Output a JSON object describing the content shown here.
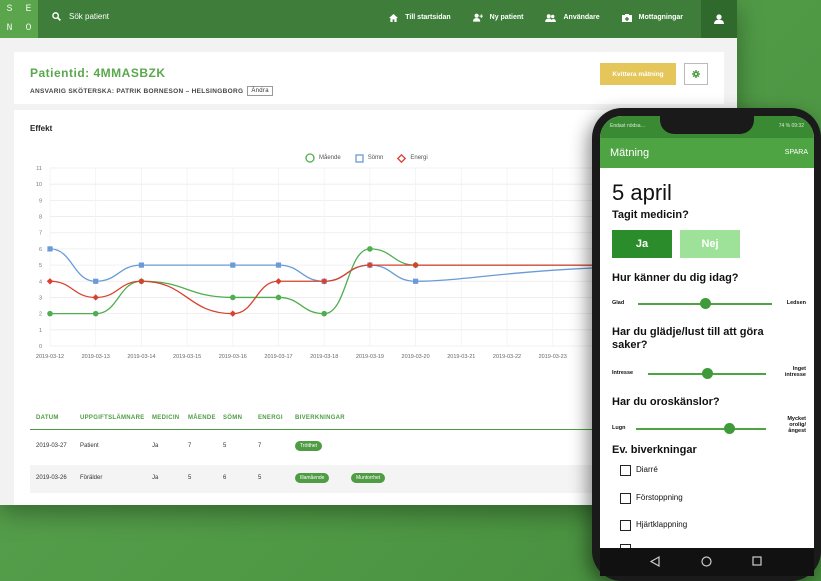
{
  "app": {
    "logo_letters": [
      "S",
      "E",
      "N",
      "O"
    ]
  },
  "topnav": {
    "search_label": "Sök patient",
    "links": [
      "Till startsidan",
      "Ny patient",
      "Användare",
      "Mottagningar"
    ]
  },
  "patient": {
    "id_label": "Patientid: 4MMASBZK",
    "responsible": "ANSVARIG SKÖTERSKA: PATRIK BORNESON – HELSINGBORG",
    "edit_label": "Ändra",
    "confirm_button": "Kvittera mätning"
  },
  "chart_title": "Effekt",
  "chart_data": {
    "type": "line",
    "x": [
      "2019-03-12",
      "2019-03-13",
      "2019-03-14",
      "2019-03-15",
      "2019-03-16",
      "2019-03-17",
      "2019-03-18",
      "2019-03-19",
      "2019-03-20",
      "2019-03-21",
      "2019-03-22",
      "2019-03-23"
    ],
    "ylim": [
      0,
      11
    ],
    "yticks": [
      0,
      1,
      2,
      3,
      4,
      5,
      6,
      7,
      8,
      9,
      10,
      11
    ],
    "series": [
      {
        "name": "Mående",
        "color": "#4fae4f",
        "marker": "circle",
        "points": [
          [
            "2019-03-12",
            2
          ],
          [
            "2019-03-13",
            2
          ],
          [
            "2019-03-14",
            4
          ],
          [
            "2019-03-16",
            3
          ],
          [
            "2019-03-17",
            3
          ],
          [
            "2019-03-18",
            2
          ],
          [
            "2019-03-19",
            6
          ],
          [
            "2019-03-20",
            5
          ]
        ]
      },
      {
        "name": "Sömn",
        "color": "#6a9bd6",
        "marker": "square",
        "points": [
          [
            "2019-03-12",
            6
          ],
          [
            "2019-03-13",
            4
          ],
          [
            "2019-03-14",
            5
          ],
          [
            "2019-03-16",
            5
          ],
          [
            "2019-03-17",
            5
          ],
          [
            "2019-03-18",
            4
          ],
          [
            "2019-03-19",
            5
          ],
          [
            "2019-03-20",
            4
          ]
        ]
      },
      {
        "name": "Energi",
        "color": "#d9412f",
        "marker": "diamond",
        "points": [
          [
            "2019-03-12",
            4
          ],
          [
            "2019-03-13",
            3
          ],
          [
            "2019-03-14",
            4
          ],
          [
            "2019-03-16",
            2
          ],
          [
            "2019-03-17",
            4
          ],
          [
            "2019-03-18",
            4
          ],
          [
            "2019-03-19",
            5
          ],
          [
            "2019-03-20",
            5
          ]
        ]
      }
    ]
  },
  "table": {
    "headers": [
      "DATUM",
      "UPPGIFTSLÄMNARE",
      "MEDICIN",
      "MÅENDE",
      "SÖMN",
      "ENERGI",
      "BIVERKNINGAR"
    ],
    "rows": [
      {
        "cells": [
          "2019-03-27",
          "Patient",
          "Ja",
          "7",
          "5",
          "7"
        ],
        "badges": [
          "Trötthet"
        ]
      },
      {
        "cells": [
          "2019-03-26",
          "Förälder",
          "Ja",
          "5",
          "6",
          "5"
        ],
        "badges": [
          "Illamående",
          "Muntorrhet"
        ]
      }
    ]
  },
  "phone": {
    "status_left": "Endast nödsa…",
    "status_right": "74 % 09:32",
    "title": "Mätning",
    "save": "SPARA",
    "date": "5 april",
    "q_medicine": "Tagit medicin?",
    "yes": "Ja",
    "no": "Nej",
    "q_feel": "Hur känner du dig idag?",
    "feel_left": "Glad",
    "feel_right": "Ledsen",
    "feel_value": 0.5,
    "q_joy": "Har du glädje/lust till att göra saker?",
    "joy_left": "Intresse",
    "joy_right": "Inget intresse",
    "joy_value": 0.5,
    "q_worry": "Har du oroskänslor?",
    "worry_left": "Lugn",
    "worry_right": "Mycket orolig/ ångest",
    "worry_value": 0.72,
    "side_effects_title": "Ev. biverkningar",
    "side_effects": [
      "Diarré",
      "Förstoppning",
      "Hjärtklappning"
    ]
  }
}
